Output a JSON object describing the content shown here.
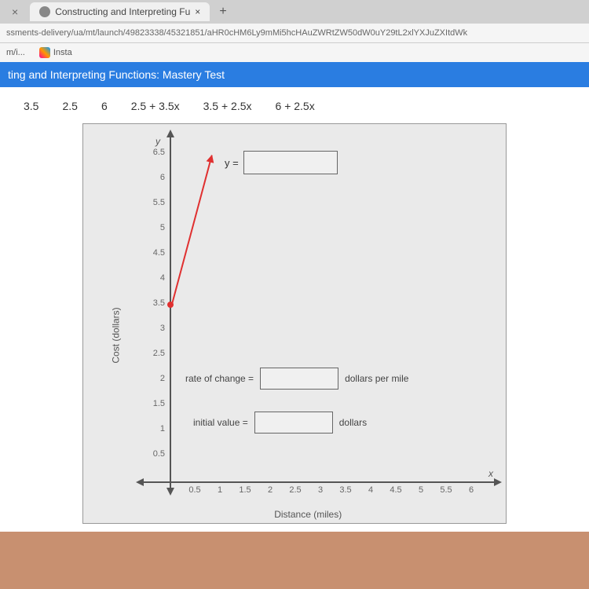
{
  "browser": {
    "tab_title": "Constructing and Interpreting Fu",
    "tab_close": "×",
    "tab_add": "+",
    "url": "ssments-delivery/ua/mt/launch/49823338/45321851/aHR0cHM6Ly9mMi5hcHAuZWRtZW50dW0uY29tL2xlYXJuZXItdWk",
    "bookmarks": [
      {
        "label": "m/i..."
      },
      {
        "label": "Insta"
      }
    ]
  },
  "test_header": "ting and Interpreting Functions: Mastery Test",
  "tiles": [
    "3.5",
    "2.5",
    "6",
    "2.5 + 3.5x",
    "3.5 + 2.5x",
    "6 + 2.5x"
  ],
  "graph": {
    "y_axis_label": "Cost (dollars)",
    "x_axis_label": "Distance (miles)",
    "y_var": "y",
    "x_var": "x",
    "y_ticks": [
      "6.5",
      "6",
      "5.5",
      "5",
      "4.5",
      "4",
      "3.5",
      "3",
      "2.5",
      "2",
      "1.5",
      "1",
      "0.5"
    ],
    "x_ticks": [
      "0.5",
      "1",
      "1.5",
      "2",
      "2.5",
      "3",
      "3.5",
      "4",
      "4.5",
      "5",
      "5.5",
      "6"
    ],
    "equation_prefix": "y =",
    "rate_label": "rate of change =",
    "rate_units": "dollars per mile",
    "initial_label": "initial value =",
    "initial_units": "dollars"
  },
  "chart_data": {
    "type": "line",
    "xlabel": "Distance (miles)",
    "ylabel": "Cost (dollars)",
    "xlim": [
      0,
      6
    ],
    "ylim": [
      0,
      6.5
    ],
    "x_tick_step": 0.5,
    "y_tick_step": 0.5,
    "series": [
      {
        "name": "cost-line",
        "points": [
          {
            "x": 0,
            "y": 3.5
          },
          {
            "x": 1,
            "y": 6
          }
        ],
        "color": "#e03030",
        "arrow_end": true,
        "marker_at": {
          "x": 0,
          "y": 3.5
        }
      }
    ],
    "drop_targets": [
      "y_equation",
      "rate_of_change",
      "initial_value"
    ]
  }
}
